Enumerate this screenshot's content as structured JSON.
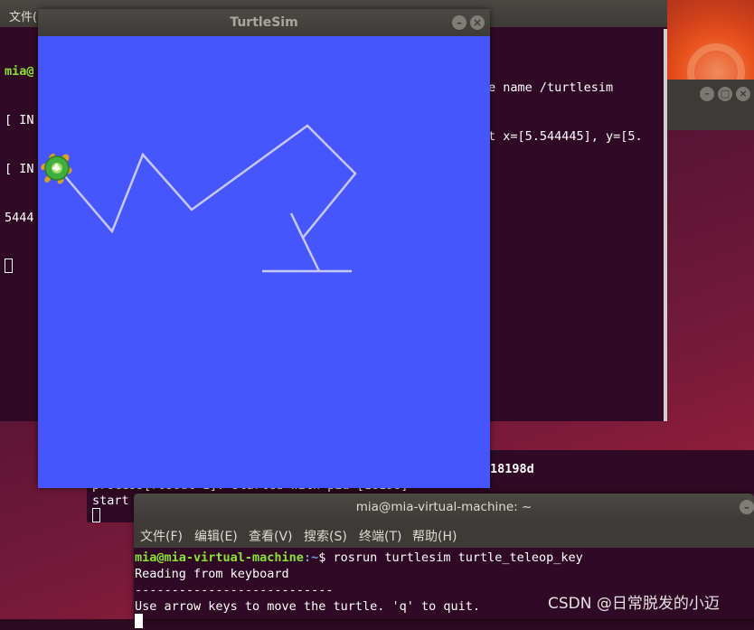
{
  "back_terminal": {
    "menu_label": "文件(",
    "prompt_user": "mia@",
    "line1": "[ IN",
    "line2": "[ IN",
    "line3": "5444",
    "right_line1": "e name /turtlesim",
    "right_line2": "t x=[5.544445], y=[5."
  },
  "right_window": {
    "minimize_icon": "–",
    "maximize_icon": "□",
    "close_icon": "×"
  },
  "middle_terminal": {
    "pid_text": "18198d",
    "line1": "process[rosout-1]: started with pid [18198]",
    "line2": "start"
  },
  "turtlesim": {
    "title": "TurtleSim",
    "minimize_icon": "–",
    "close_icon": "×",
    "background": "#4556ff",
    "trail_color": "#c6c8f0",
    "turtle_icon": "turtle-icon"
  },
  "front_terminal": {
    "title": "mia@mia-virtual-machine: ~",
    "menu": [
      "文件(F)",
      "编辑(E)",
      "查看(V)",
      "搜索(S)",
      "终端(T)",
      "帮助(H)"
    ],
    "prompt_user": "mia@mia-virtual-machine",
    "prompt_path": ":~",
    "prompt_symbol": "$ ",
    "command": "rosrun turtlesim turtle_teleop_key",
    "output1": "Reading from keyboard",
    "output2": "---------------------------",
    "output3": "Use arrow keys to move the turtle. 'q' to quit."
  },
  "watermark": "CSDN @日常脱发的小迈"
}
